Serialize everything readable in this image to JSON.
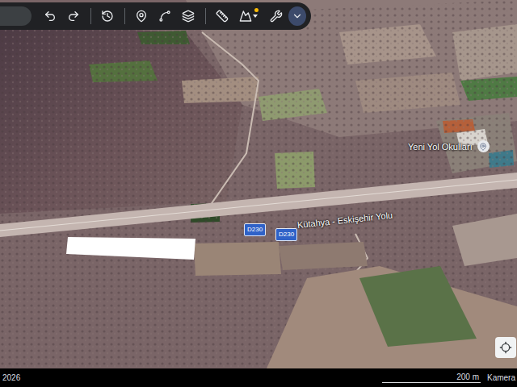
{
  "toolbar": {
    "imagery_badge": true
  },
  "map": {
    "places": [
      {
        "text": "Yeni Yol Okulları",
        "kind": "place"
      }
    ],
    "road_shields": [
      "D230",
      "D230"
    ],
    "road_name": "Kütahya - Eskişehir Yolu"
  },
  "status_bar": {
    "date": "2026",
    "scale": "200 m",
    "camera": "Kamera"
  }
}
